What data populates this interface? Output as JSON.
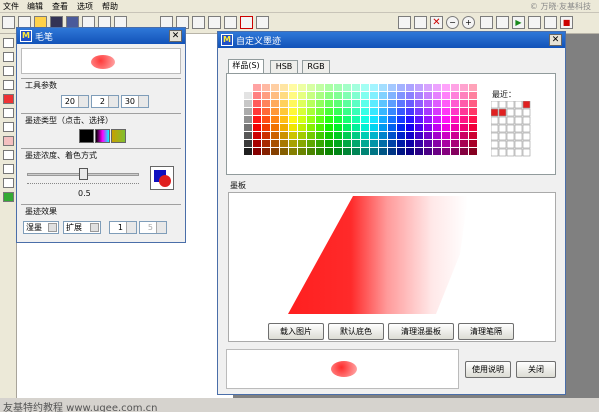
{
  "menu": {
    "items": [
      "文件",
      "编辑",
      "查看",
      "选项",
      "帮助"
    ]
  },
  "watermark": "© 万晓·友基科技",
  "footer_text": "友基特约教程 www.ugee.com.cn",
  "brush_window": {
    "title": "毛笔",
    "tool_params_label": "工具参数",
    "param_values": [
      "20",
      "2",
      "30"
    ],
    "ink_type_label": "墨迹类型（点击、选择）",
    "ink_density_label": "墨迹浓度、着色方式",
    "density_value": "0.5",
    "slider_level": 0.5,
    "ink_effect_label": "墨迹效果",
    "effect_combo1": "湿墨",
    "effect_combo2": "扩展",
    "effect_spin1": "1",
    "effect_spin2": "5"
  },
  "custom_window": {
    "title": "自定义墨迹",
    "tabs": [
      "样品(S)",
      "HSB",
      "RGB"
    ],
    "recent_label": "最近：",
    "inkboard_label": "墨板",
    "buttons": [
      "载入图片",
      "默认底色",
      "清理混墨板",
      "清理笔隔"
    ],
    "help_button": "使用说明",
    "close_button": "关闭"
  },
  "colors": {
    "title_blue": "#1f66cc",
    "ink_red": "#ff2020"
  }
}
